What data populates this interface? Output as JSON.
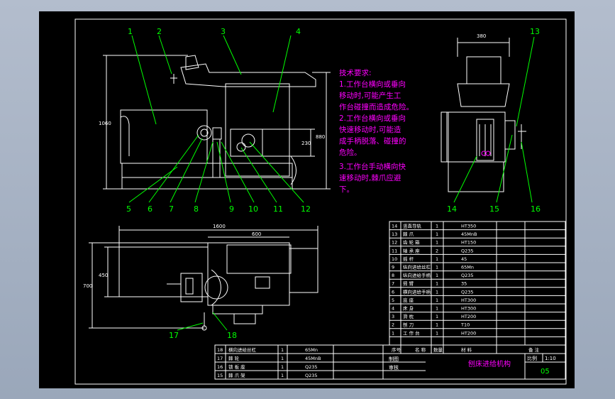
{
  "callouts_top": [
    "1",
    "2",
    "3",
    "4"
  ],
  "callouts_bottom": [
    "5",
    "6",
    "7",
    "8",
    "9",
    "10",
    "11",
    "12"
  ],
  "callouts_side": [
    "13",
    "14",
    "15",
    "16"
  ],
  "callouts_plan": [
    "17",
    "18"
  ],
  "dims": {
    "d1060": "1060",
    "d880": "880",
    "d230": "230",
    "d380": "380",
    "d1600": "1600",
    "d600": "600",
    "d450": "450",
    "d700": "700"
  },
  "notes": {
    "title": "技术要求:",
    "lines": [
      "1.工作台横向或垂向",
      "移动时,可能产生工",
      "作台碰撞而造成危险。",
      "2.工作台横向或垂向",
      "快速移动时,可能造",
      "成手柄脱落、碰撞的",
      "危险。",
      "3.工作台手动横向快",
      "速移动时,棘爪应避",
      "下。"
    ]
  },
  "bom_upper": [
    [
      "14",
      "竖直导轨",
      "1",
      "HT350",
      ""
    ],
    [
      "13",
      "棘 爪",
      "1",
      "45MnB",
      ""
    ],
    [
      "12",
      "齿 轮 箱",
      "1",
      "HT150",
      ""
    ],
    [
      "11",
      "轴 承 座",
      "2",
      "Q235",
      ""
    ],
    [
      "10",
      "摇 杆",
      "1",
      "45",
      ""
    ],
    [
      "9",
      "纵向进给丝杠",
      "1",
      "65Mn",
      ""
    ],
    [
      "8",
      "纵向进给手柄",
      "1",
      "Q235",
      ""
    ],
    [
      "7",
      "摇 臂",
      "1",
      "35",
      ""
    ],
    [
      "6",
      "横向进给手柄",
      "1",
      "Q235",
      ""
    ],
    [
      "5",
      "底 座",
      "1",
      "HT300",
      ""
    ],
    [
      "4",
      "床 身",
      "1",
      "HT300",
      ""
    ],
    [
      "3",
      "滑 枕",
      "1",
      "HT200",
      ""
    ],
    [
      "2",
      "刨 刀",
      "1",
      "T10",
      ""
    ],
    [
      "1",
      "工 作 台",
      "1",
      "HT200",
      ""
    ]
  ],
  "bom_lower": [
    [
      "18",
      "横向进给丝杠",
      "1",
      "65Mn"
    ],
    [
      "17",
      "棘 轮",
      "1",
      "45MnB"
    ],
    [
      "16",
      "锁 板 座",
      "1",
      "Q235"
    ],
    [
      "15",
      "棘 爪 架",
      "1",
      "Q235"
    ]
  ],
  "header_row": [
    "序号",
    "名 称",
    "数量",
    "材 料",
    "备 注"
  ],
  "title_block": {
    "drawn": "制图",
    "checked": "审核",
    "name": "刨床进给机构",
    "scale_label": "比例",
    "scale": "1:10",
    "sheet": "05"
  }
}
